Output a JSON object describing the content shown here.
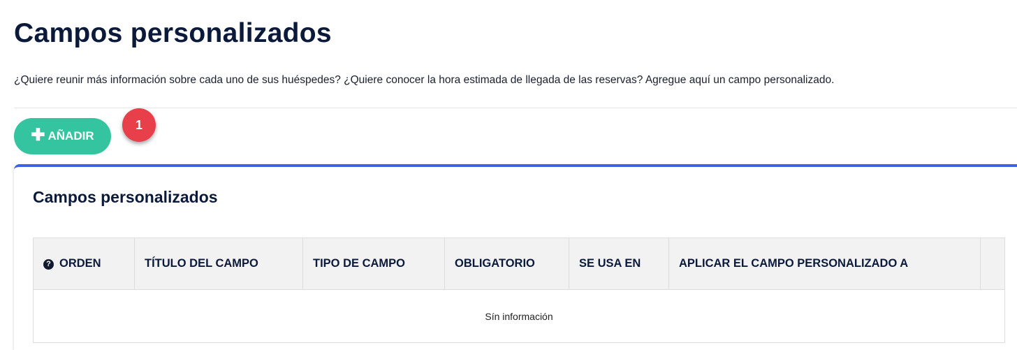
{
  "page": {
    "title": "Campos personalizados",
    "description": "¿Quiere reunir más información sobre cada uno de sus huéspedes? ¿Quiere conocer la hora estimada de llegada de las reservas? Agregue aquí un campo personalizado."
  },
  "toolbar": {
    "add_label": "AÑADIR",
    "add_icon": "plus-icon"
  },
  "step_badge": "1",
  "card": {
    "title": "Campos personalizados"
  },
  "table": {
    "columns": [
      "ORDEN",
      "TÍTULO DEL CAMPO",
      "TIPO DE CAMPO",
      "OBLIGATORIO",
      "SE USA EN",
      "APLICAR EL CAMPO PERSONALIZADO A",
      ""
    ],
    "help_icon": "question-circle-icon",
    "empty_message": "Sín información"
  },
  "colors": {
    "title": "#0b1a3a",
    "add_button": "#34c4a0",
    "badge": "#e8404a",
    "card_accent": "#3a63e6",
    "header_bg": "#f2f2f2"
  }
}
